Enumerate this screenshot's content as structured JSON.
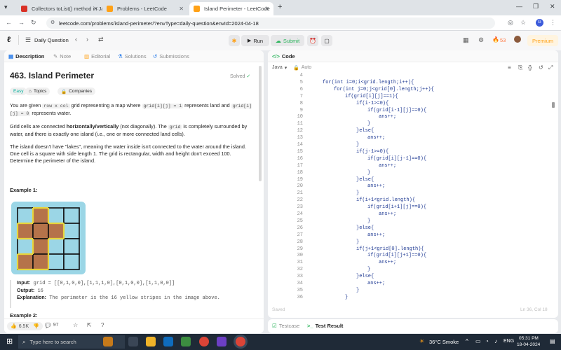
{
  "browser": {
    "tabs": [
      {
        "title": "Collectors toList() method in Jav"
      },
      {
        "title": "Problems - LeetCode"
      },
      {
        "title": "Island Perimeter - LeetCode"
      }
    ],
    "url": "leetcode.com/problems/island-perimeter/?envType=daily-question&envId=2024-04-18"
  },
  "lc_nav": {
    "daily_question": "Daily Question",
    "run": "Run",
    "submit": "Submit",
    "streak": "53",
    "premium": "Premium"
  },
  "left_tabs": [
    "Description",
    "Note",
    "Editorial",
    "Solutions",
    "Submissions"
  ],
  "problem": {
    "title": "463. Island Perimeter",
    "status": "Solved",
    "difficulty": "Easy",
    "topics": "Topics",
    "companies": "Companies",
    "p1_a": "You are given ",
    "p1_code1": "row x col",
    "p1_b": " grid representing a map where ",
    "p1_code2": "grid[i][j] = 1",
    "p1_c": " represents land and ",
    "p1_code3": "grid[i][j] = 0",
    "p1_d": " represents water.",
    "p2_a": "Grid cells are connected ",
    "p2_bold": "horizontally/vertically",
    "p2_b": " (not diagonally). The ",
    "p2_code": "grid",
    "p2_c": " is completely surrounded by water, and there is exactly one island (i.e., one or more connected land cells).",
    "p3": "The island doesn't have \"lakes\", meaning the water inside isn't connected to the water around the island. One cell is a square with side length 1. The grid is rectangular, width and height don't exceed 100. Determine the perimeter of the island.",
    "example1_title": "Example 1:",
    "input_label": "Input:",
    "input_value": "grid = [[0,1,0,0],[1,1,1,0],[0,1,0,0],[1,1,0,0]]",
    "output_label": "Output:",
    "output_value": "16",
    "explanation_label": "Explanation:",
    "explanation_value": "The perimeter is the 16 yellow stripes in the image above.",
    "example2_title": "Example 2:",
    "grid": [
      [
        0,
        1,
        0,
        0
      ],
      [
        1,
        1,
        1,
        0
      ],
      [
        0,
        1,
        0,
        0
      ],
      [
        1,
        1,
        0,
        0
      ]
    ],
    "likes": "6.5K",
    "comments": "97"
  },
  "code_panel": {
    "title": "Code",
    "language": "Java",
    "auto": "Auto",
    "saved": "Saved",
    "cursor": "Ln 36, Col 18",
    "testcase": "Testcase",
    "test_result": "Test Result",
    "lines": [
      {
        "n": "4",
        "indent": 0,
        "text": ""
      },
      {
        "n": "5",
        "indent": 1,
        "text": "for(int i=0;i<grid.length;i++){"
      },
      {
        "n": "6",
        "indent": 2,
        "text": "for(int j=0;j<grid[0].length;j++){"
      },
      {
        "n": "7",
        "indent": 3,
        "text": "if(grid[i][j]==1){"
      },
      {
        "n": "8",
        "indent": 4,
        "text": "if(i-1>=0){"
      },
      {
        "n": "9",
        "indent": 5,
        "text": "if(grid[i-1][j]==0){"
      },
      {
        "n": "10",
        "indent": 6,
        "text": "ans++;"
      },
      {
        "n": "11",
        "indent": 5,
        "text": "}"
      },
      {
        "n": "12",
        "indent": 4,
        "text": "}else{"
      },
      {
        "n": "13",
        "indent": 5,
        "text": "ans++;"
      },
      {
        "n": "14",
        "indent": 4,
        "text": "}"
      },
      {
        "n": "15",
        "indent": 4,
        "text": "if(j-1>=0){"
      },
      {
        "n": "16",
        "indent": 5,
        "text": "if(grid[i][j-1]==0){"
      },
      {
        "n": "17",
        "indent": 6,
        "text": "ans++;"
      },
      {
        "n": "18",
        "indent": 5,
        "text": "}"
      },
      {
        "n": "19",
        "indent": 4,
        "text": "}else{"
      },
      {
        "n": "20",
        "indent": 5,
        "text": "ans++;"
      },
      {
        "n": "21",
        "indent": 4,
        "text": "}"
      },
      {
        "n": "22",
        "indent": 4,
        "text": "if(i+1<grid.length){"
      },
      {
        "n": "23",
        "indent": 5,
        "text": "if(grid[i+1][j]==0){"
      },
      {
        "n": "24",
        "indent": 6,
        "text": "ans++;"
      },
      {
        "n": "25",
        "indent": 5,
        "text": "}"
      },
      {
        "n": "26",
        "indent": 4,
        "text": "}else{"
      },
      {
        "n": "27",
        "indent": 5,
        "text": "ans++;"
      },
      {
        "n": "28",
        "indent": 4,
        "text": "}"
      },
      {
        "n": "29",
        "indent": 4,
        "text": "if(j+1<grid[0].length){"
      },
      {
        "n": "30",
        "indent": 5,
        "text": "if(grid[i][j+1]==0){"
      },
      {
        "n": "31",
        "indent": 6,
        "text": "ans++;"
      },
      {
        "n": "32",
        "indent": 5,
        "text": "}"
      },
      {
        "n": "33",
        "indent": 4,
        "text": "}else{"
      },
      {
        "n": "34",
        "indent": 5,
        "text": "ans++;"
      },
      {
        "n": "35",
        "indent": 4,
        "text": "}"
      },
      {
        "n": "36",
        "indent": 3,
        "text": "}"
      }
    ]
  },
  "taskbar": {
    "search_placeholder": "Type here to search",
    "weather": "36°C Smoke",
    "lang": "ENG",
    "time": "05:31 PM",
    "date": "18-04-2024"
  },
  "colors": {
    "land": "#b5734a",
    "water": "#9bd6e6",
    "border": "#e8d53a",
    "submit_green": "#2db55d",
    "premium_orange": "#ffa116"
  }
}
